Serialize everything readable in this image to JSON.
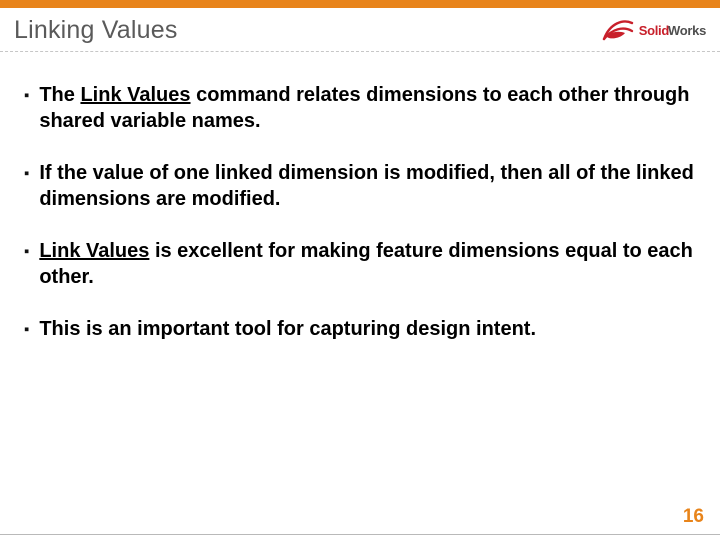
{
  "header": {
    "title": "Linking Values",
    "logo": {
      "brand_part1": "Solid",
      "brand_part2": "Works"
    }
  },
  "bullets": [
    {
      "pre": "The ",
      "u": "Link Values",
      "post": " command relates dimensions to each other through shared variable names."
    },
    {
      "pre": "If the value of one linked dimension is modified, then all of the linked dimensions are modified.",
      "u": "",
      "post": ""
    },
    {
      "pre": "",
      "u": "Link Values",
      "post": " is excellent for making feature dimensions equal to each other."
    },
    {
      "pre": "This is an important tool for capturing design intent.",
      "u": "",
      "post": ""
    }
  ],
  "page_number": "16",
  "colors": {
    "accent": "#e8841b",
    "brand_red": "#c8202b"
  }
}
